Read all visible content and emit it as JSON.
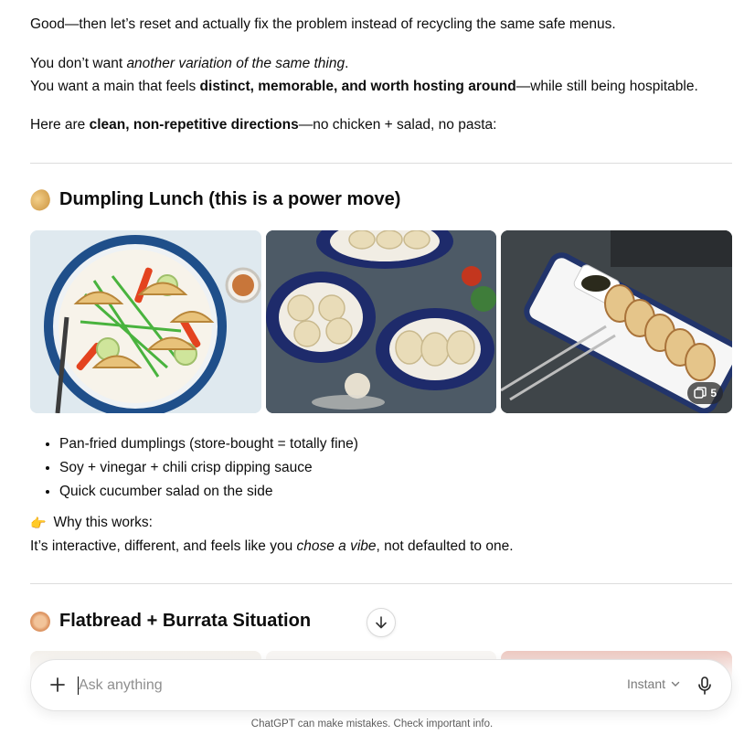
{
  "message": {
    "p1": "Good—then let’s reset and actually fix the problem instead of recycling the same safe menus.",
    "p2_pre": "You don’t want ",
    "p2_em": "another variation of the same thing",
    "p2_post": ".",
    "p3_pre": "You want a main that feels ",
    "p3_bold": "distinct, memorable, and worth hosting around",
    "p3_post": "—while still being hospitable.",
    "p4_pre": "Here are ",
    "p4_bold": "clean, non-repetitive directions",
    "p4_post": "—no chicken + salad, no pasta:"
  },
  "section1": {
    "heading": "Dumpling Lunch (this is a power move)",
    "image_count": "5",
    "bullets": [
      "Pan-fried dumplings (store-bought = totally fine)",
      "Soy + vinegar + chili crisp dipping sauce",
      "Quick cucumber salad on the side"
    ],
    "why_label": "Why this works:",
    "why_pre": "It’s interactive, different, and feels like you ",
    "why_em": "chose a vibe",
    "why_post": ", not defaulted to one."
  },
  "section2": {
    "heading": "Flatbread + Burrata Situation"
  },
  "composer": {
    "placeholder": "Ask anything",
    "mode": "Instant"
  },
  "disclaimer": "ChatGPT can make mistakes. Check important info."
}
